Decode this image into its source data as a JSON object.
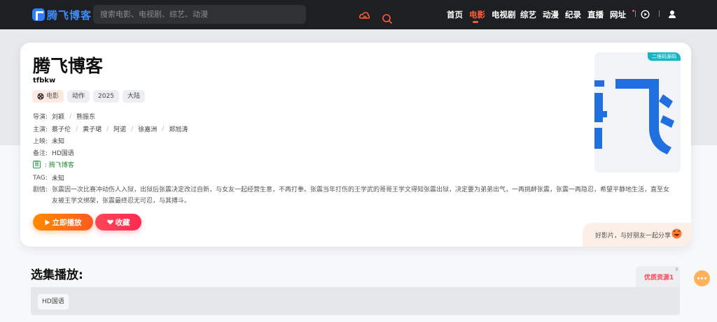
{
  "header": {
    "logo_text": "腾飞博客",
    "search_placeholder": "搜索电影、电视剧、综艺、动漫",
    "nav": [
      {
        "label": "首页"
      },
      {
        "label": "电影",
        "active": true
      },
      {
        "label": "电视剧"
      },
      {
        "label": "综艺"
      },
      {
        "label": "动漫"
      },
      {
        "label": "纪录"
      },
      {
        "label": "直播"
      },
      {
        "label": "网址"
      }
    ],
    "accent_color": "#ff5a37"
  },
  "movie": {
    "title": "腾飞博客",
    "subtitle": "tfbkw",
    "type_tag": "电影",
    "tags": [
      "动作",
      "2025",
      "大陆"
    ],
    "director_label": "导演:",
    "directors": [
      "刘颖",
      "熊振东"
    ],
    "cast_label": "主演:",
    "cast": [
      "蔡子伦",
      "黄子珺",
      "阿诺",
      "徐嘉洲",
      "郑旭涛"
    ],
    "release_label": "上映:",
    "release": "未知",
    "note_label": "备注:",
    "note": "HD国语",
    "douban_icon": "豆",
    "douban_link": ": 腾飞博客",
    "tag_label": "TAG:",
    "tag_value": "未知",
    "plot_label": "剧情:",
    "plot": "张震因一次比赛冲动伤人入狱，出狱后张震决定改过自新，与女友一起经营生意，不再打拳。张震当年打伤的王学武的哥哥王学文得知张震出狱，决定要为弟弟出气，一再挑衅张震，张震一再隐忍，希望平静地生活，直至女友被王学文绑架，张震最终忍无可忍，与其搏斗。",
    "play_label": "立即播放",
    "fav_label": "收藏",
    "poster_badge": "二维码源码",
    "share_text": "好影片，与好朋友一起分享"
  },
  "episodes": {
    "section_title": "选集播放:",
    "source_tab": "优质资源1",
    "items": [
      "HD国语"
    ]
  },
  "colors": {
    "play_gradient": [
      "#ff8a00",
      "#ff5a1f"
    ],
    "fav_gradient": [
      "#ff4657",
      "#ff2a50"
    ],
    "poster_blue": "#1f6fe0"
  }
}
